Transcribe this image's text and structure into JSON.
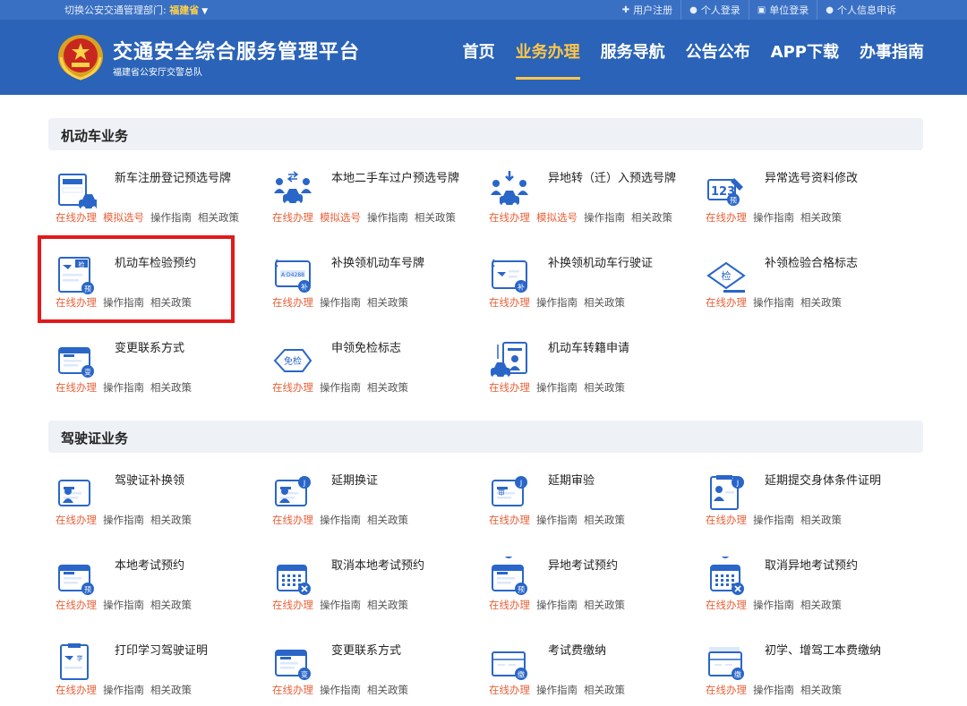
{
  "topbar": {
    "switch_label": "切换公安交通管理部门:",
    "province": "福建省",
    "links": [
      {
        "icon": "plus-icon",
        "glyph": "✚",
        "label": "用户注册"
      },
      {
        "icon": "user-icon",
        "glyph": "●",
        "label": "个人登录"
      },
      {
        "icon": "building-icon",
        "glyph": "▣",
        "label": "单位登录"
      },
      {
        "icon": "user-icon",
        "glyph": "●",
        "label": "个人信息申诉"
      }
    ]
  },
  "header": {
    "title": "交通安全综合服务管理平台",
    "subtitle": "福建省公安厅交警总队",
    "nav": [
      "首页",
      "业务办理",
      "服务导航",
      "公告公布",
      "APP下载",
      "办事指南"
    ],
    "active_nav": 1
  },
  "colors": {
    "header_bg": "#2a63b7",
    "accent": "#ffc64a",
    "link_orange": "#e8623a",
    "icon_blue": "#2a66c8",
    "highlight_red": "#e21a1a"
  },
  "sections": [
    {
      "title": "机动车业务",
      "items": [
        {
          "title": "新车注册登记预选号牌",
          "icon": "new-car-plate-icon",
          "links": [
            "在线办理",
            "模拟选号",
            "操作指南",
            "相关政策"
          ]
        },
        {
          "title": "本地二手车过户预选号牌",
          "icon": "car-transfer-icon",
          "links": [
            "在线办理",
            "模拟选号",
            "操作指南",
            "相关政策"
          ]
        },
        {
          "title": "异地转（迁）入预选号牌",
          "icon": "car-migrate-in-icon",
          "links": [
            "在线办理",
            "模拟选号",
            "操作指南",
            "相关政策"
          ]
        },
        {
          "title": "异常选号资料修改",
          "icon": "number-edit-icon",
          "links": [
            "在线办理",
            "操作指南",
            "相关政策"
          ]
        },
        {
          "title": "机动车检验预约",
          "icon": "inspection-booking-icon",
          "links": [
            "在线办理",
            "操作指南",
            "相关政策"
          ]
        },
        {
          "title": "补换领机动车号牌",
          "icon": "replace-plate-icon",
          "links": [
            "在线办理",
            "操作指南",
            "相关政策"
          ]
        },
        {
          "title": "补换领机动车行驶证",
          "icon": "replace-license-icon",
          "links": [
            "在线办理",
            "操作指南",
            "相关政策"
          ]
        },
        {
          "title": "补领检验合格标志",
          "icon": "inspection-badge-icon",
          "links": [
            "在线办理",
            "操作指南",
            "相关政策"
          ]
        },
        {
          "title": "变更联系方式",
          "icon": "contact-change-icon",
          "links": [
            "在线办理",
            "操作指南",
            "相关政策"
          ]
        },
        {
          "title": "申领免检标志",
          "icon": "exemption-badge-icon",
          "links": [
            "在线办理",
            "操作指南",
            "相关政策"
          ]
        },
        {
          "title": "机动车转籍申请",
          "icon": "vehicle-transfer-icon",
          "links": [
            "在线办理",
            "操作指南",
            "相关政策"
          ]
        }
      ]
    },
    {
      "title": "驾驶证业务",
      "items": [
        {
          "title": "驾驶证补换领",
          "icon": "license-replace-icon",
          "links": [
            "在线办理",
            "操作指南",
            "相关政策"
          ]
        },
        {
          "title": "延期换证",
          "icon": "delay-renew-icon",
          "links": [
            "在线办理",
            "操作指南",
            "相关政策"
          ]
        },
        {
          "title": "延期审验",
          "icon": "delay-review-icon",
          "links": [
            "在线办理",
            "操作指南",
            "相关政策"
          ]
        },
        {
          "title": "延期提交身体条件证明",
          "icon": "delay-health-icon",
          "links": [
            "在线办理",
            "操作指南",
            "相关政策"
          ]
        },
        {
          "title": "本地考试预约",
          "icon": "exam-booking-icon",
          "links": [
            "在线办理",
            "操作指南",
            "相关政策"
          ]
        },
        {
          "title": "取消本地考试预约",
          "icon": "exam-cancel-icon",
          "links": [
            "在线办理",
            "操作指南",
            "相关政策"
          ]
        },
        {
          "title": "异地考试预约",
          "icon": "remote-exam-booking-icon",
          "links": [
            "在线办理",
            "操作指南",
            "相关政策"
          ]
        },
        {
          "title": "取消异地考试预约",
          "icon": "remote-exam-cancel-icon",
          "links": [
            "在线办理",
            "操作指南",
            "相关政策"
          ]
        },
        {
          "title": "打印学习驾驶证明",
          "icon": "print-learner-icon",
          "links": [
            "在线办理",
            "操作指南",
            "相关政策"
          ]
        },
        {
          "title": "变更联系方式",
          "icon": "contact-change-icon",
          "links": [
            "在线办理",
            "操作指南",
            "相关政策"
          ]
        },
        {
          "title": "考试费缴纳",
          "icon": "exam-fee-icon",
          "links": [
            "在线办理",
            "操作指南",
            "相关政策"
          ]
        },
        {
          "title": "初学、增驾工本费缴纳",
          "icon": "production-fee-icon",
          "links": [
            "在线办理",
            "操作指南",
            "相关政策"
          ]
        }
      ]
    }
  ]
}
